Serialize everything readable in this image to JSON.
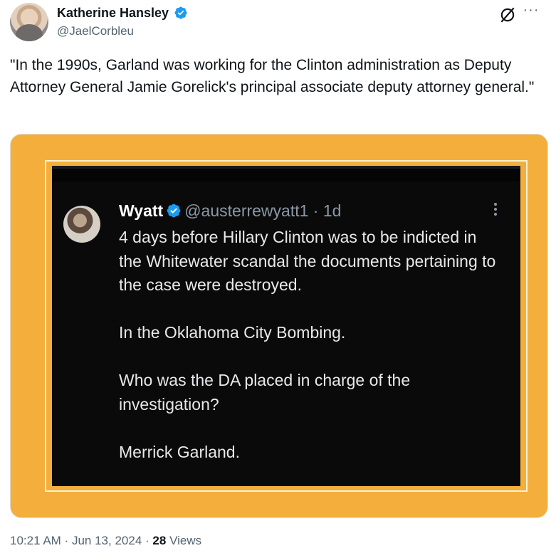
{
  "author": {
    "display_name": "Katherine Hansley",
    "handle": "@JaelCorbleu",
    "verified": true
  },
  "header_icons": [
    "grok-icon",
    "more-icon"
  ],
  "tweet": {
    "text": "\"In the 1990s, Garland was working for the Clinton administration as Deputy Attorney General Jamie Gorelick's principal associate deputy attorney general.\""
  },
  "media": {
    "border_color": "#f3ae3b",
    "quoted_post": {
      "name": "Wyatt",
      "handle": "@austerrewyatt1",
      "separator": "·",
      "time": "1d",
      "paragraphs": [
        "4 days before Hillary Clinton was to be indicted in the Whitewater scandal the documents pertaining to the case were destroyed.",
        "In the Oklahoma City Bombing.",
        "Who was the DA placed in charge of the investigation?",
        "Merrick Garland."
      ]
    }
  },
  "meta": {
    "time": "10:21 AM",
    "dot1": "·",
    "date": "Jun 13, 2024",
    "dot2": "·",
    "views_count": "28",
    "views_label": "Views"
  },
  "colors": {
    "accent": "#1d9bf0",
    "text_primary": "#0f1419",
    "text_secondary": "#536471"
  }
}
